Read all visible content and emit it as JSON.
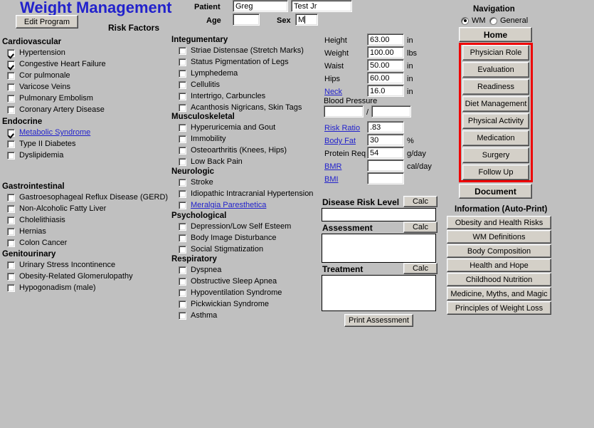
{
  "app": {
    "title": "Weight Management",
    "edit_program_label": "Edit Program",
    "risk_factors_heading": "Risk Factors"
  },
  "patient": {
    "patient_label": "Patient",
    "age_label": "Age",
    "sex_label": "Sex",
    "first_name": "Greg",
    "last_name": "Test Jr",
    "age": "",
    "sex": "M"
  },
  "risk_groups": [
    {
      "heading": "Cardiovascular",
      "items": [
        {
          "label": "Hypertension",
          "checked": true,
          "link": false
        },
        {
          "label": "Congestive Heart Failure",
          "checked": true,
          "link": false
        },
        {
          "label": "Cor pulmonale",
          "checked": false,
          "link": false
        },
        {
          "label": "Varicose Veins",
          "checked": false,
          "link": false
        },
        {
          "label": "Pulmonary Embolism",
          "checked": false,
          "link": false
        },
        {
          "label": "Coronary Artery Disease",
          "checked": false,
          "link": false
        }
      ]
    },
    {
      "heading": "Endocrine",
      "items": [
        {
          "label": "Metabolic Syndrome",
          "checked": true,
          "link": true
        },
        {
          "label": "Type II Diabetes",
          "checked": false,
          "link": false
        },
        {
          "label": "Dyslipidemia",
          "checked": false,
          "link": false
        }
      ]
    },
    {
      "heading": "Gastrointestinal",
      "items": [
        {
          "label": "Gastroesophageal Reflux Disease (GERD)",
          "checked": false,
          "link": false
        },
        {
          "label": "Non-Alcoholic Fatty Liver",
          "checked": false,
          "link": false
        },
        {
          "label": "Cholelithiasis",
          "checked": false,
          "link": false
        },
        {
          "label": "Hernias",
          "checked": false,
          "link": false
        },
        {
          "label": "Colon Cancer",
          "checked": false,
          "link": false
        }
      ]
    },
    {
      "heading": "Genitourinary",
      "items": [
        {
          "label": "Urinary Stress Incontinence",
          "checked": false,
          "link": false
        },
        {
          "label": "Obesity-Related Glomerulopathy",
          "checked": false,
          "link": false
        },
        {
          "label": "Hypogonadism (male)",
          "checked": false,
          "link": false
        }
      ]
    },
    {
      "heading": "Integumentary",
      "items": [
        {
          "label": "Striae Distensae (Stretch Marks)",
          "checked": false,
          "link": false
        },
        {
          "label": "Status Pigmentation of Legs",
          "checked": false,
          "link": false
        },
        {
          "label": "Lymphedema",
          "checked": false,
          "link": false
        },
        {
          "label": "Cellulitis",
          "checked": false,
          "link": false
        },
        {
          "label": "Intertrigo, Carbuncles",
          "checked": false,
          "link": false
        },
        {
          "label": "Acanthosis Nigricans, Skin Tags",
          "checked": false,
          "link": false
        }
      ]
    },
    {
      "heading": "Musculoskeletal",
      "items": [
        {
          "label": "Hyperuricemia and Gout",
          "checked": false,
          "link": false
        },
        {
          "label": "Immobility",
          "checked": false,
          "link": false
        },
        {
          "label": "Osteoarthritis (Knees, Hips)",
          "checked": false,
          "link": false
        },
        {
          "label": "Low Back Pain",
          "checked": false,
          "link": false
        }
      ]
    },
    {
      "heading": "Neurologic",
      "items": [
        {
          "label": "Stroke",
          "checked": false,
          "link": false
        },
        {
          "label": "Idiopathic Intracranial Hypertension",
          "checked": false,
          "link": false
        },
        {
          "label": "Meralgia Paresthetica",
          "checked": false,
          "link": true
        }
      ]
    },
    {
      "heading": "Psychological",
      "items": [
        {
          "label": "Depression/Low Self Esteem",
          "checked": false,
          "link": false
        },
        {
          "label": "Body Image Disturbance",
          "checked": false,
          "link": false
        },
        {
          "label": "Social Stigmatization",
          "checked": false,
          "link": false
        }
      ]
    },
    {
      "heading": "Respiratory",
      "items": [
        {
          "label": "Dyspnea",
          "checked": false,
          "link": false
        },
        {
          "label": "Obstructive Sleep Apnea",
          "checked": false,
          "link": false
        },
        {
          "label": "Hypoventilation Syndrome",
          "checked": false,
          "link": false
        },
        {
          "label": "Pickwickian Syndrome",
          "checked": false,
          "link": false
        },
        {
          "label": "Asthma",
          "checked": false,
          "link": false
        }
      ]
    }
  ],
  "measurements": {
    "rows": [
      {
        "label": "Height",
        "value": "63.00",
        "unit": "in",
        "link": false
      },
      {
        "label": "Weight",
        "value": "100.00",
        "unit": "lbs",
        "link": false
      },
      {
        "label": "Waist",
        "value": "50.00",
        "unit": "in",
        "link": false
      },
      {
        "label": "Hips",
        "value": "60.00",
        "unit": "in",
        "link": false
      },
      {
        "label": "Neck",
        "value": "16.0",
        "unit": "in",
        "link": true
      },
      {
        "label": "Risk Ratio",
        "value": ".83",
        "unit": "",
        "link": true
      },
      {
        "label": "Body Fat",
        "value": "30",
        "unit": "%",
        "link": true
      },
      {
        "label": "Protein Req",
        "value": "54",
        "unit": "g/day",
        "link": false
      },
      {
        "label": "BMR",
        "value": "",
        "unit": "cal/day",
        "link": true
      },
      {
        "label": "BMI",
        "value": "",
        "unit": "",
        "link": true
      }
    ],
    "blood_pressure_label": "Blood Pressure",
    "bp_systolic": "",
    "bp_diastolic": "",
    "bp_separator": "/"
  },
  "assessment": {
    "disease_risk_label": "Disease Risk Level",
    "disease_risk_value": "",
    "assessment_label": "Assessment",
    "assessment_value": "",
    "treatment_label": "Treatment",
    "treatment_value": "",
    "calc_label": "Calc",
    "print_label": "Print Assessment"
  },
  "navigation": {
    "heading": "Navigation",
    "mode_wm": "WM",
    "mode_general": "General",
    "mode_selected": "WM",
    "home_label": "Home",
    "document_label": "Document",
    "highlight_color": "#ee0000",
    "items": [
      {
        "label": "Physician Role"
      },
      {
        "label": "Evaluation"
      },
      {
        "label": "Readiness"
      },
      {
        "label": "Diet Management"
      },
      {
        "label": "Physical Activity"
      },
      {
        "label": "Medication"
      },
      {
        "label": "Surgery"
      },
      {
        "label": "Follow Up"
      }
    ]
  },
  "information": {
    "heading": "Information (Auto-Print)",
    "items": [
      {
        "label": "Obesity and Health Risks"
      },
      {
        "label": "WM Definitions"
      },
      {
        "label": "Body Composition"
      },
      {
        "label": "Health and Hope"
      },
      {
        "label": "Childhood Nutrition"
      },
      {
        "label": "Medicine, Myths, and Magic"
      },
      {
        "label": "Principles of Weight Loss"
      }
    ]
  }
}
